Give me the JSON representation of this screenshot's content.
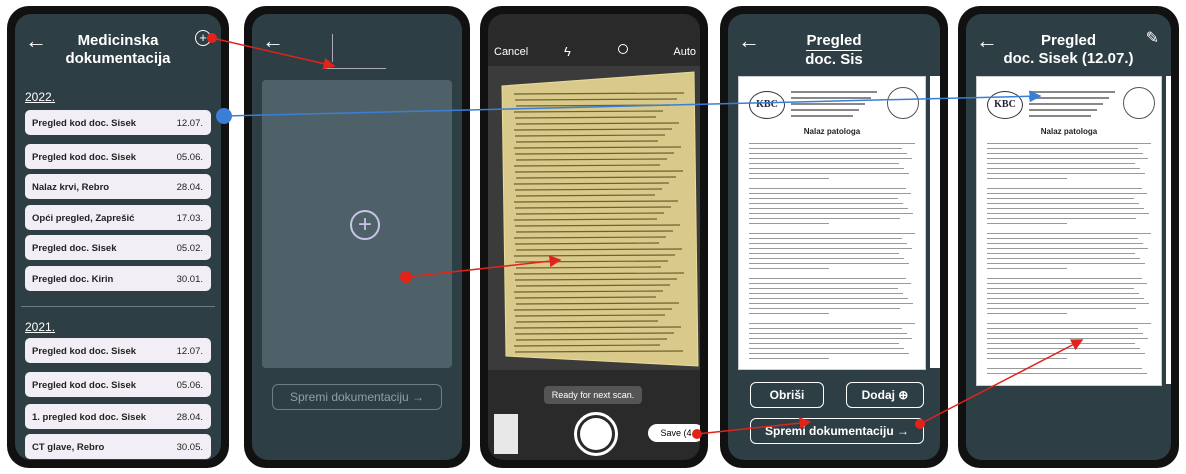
{
  "screen1": {
    "back_icon": "arrow-left-icon",
    "title_line1": "Medicinska",
    "title_line2": "dokumentacija",
    "add_icon": "plus-circle-icon",
    "year1": "2022.",
    "items2022": [
      {
        "label": "Pregled kod doc. Sisek",
        "date": "12.07."
      },
      {
        "label": "Pregled kod doc. Sisek",
        "date": "05.06."
      },
      {
        "label": "Nalaz krvi, Rebro",
        "date": "28.04."
      },
      {
        "label": "Opći pregled, Zaprešić",
        "date": "17.03."
      },
      {
        "label": "Pregled doc. Sisek",
        "date": "05.02."
      },
      {
        "label": "Pregled doc. Kirin",
        "date": "30.01."
      }
    ],
    "year2": "2021.",
    "items2021": [
      {
        "label": "Pregled kod doc. Sisek",
        "date": "12.07."
      },
      {
        "label": "Pregled kod doc. Sisek",
        "date": "05.06."
      },
      {
        "label": "1. pregled kod doc. Sisek",
        "date": "28.04."
      },
      {
        "label": "CT glave, Rebro",
        "date": "30.05."
      }
    ]
  },
  "screen2": {
    "back_icon": "arrow-left-icon",
    "add_icon": "plus-circle-icon",
    "save_label": "Spremi dokumentaciju →"
  },
  "screen3": {
    "cancel": "Cancel",
    "flash_icon": "lightning-icon",
    "filter_icon": "filter-icon",
    "auto": "Auto",
    "toast": "Ready for next scan.",
    "save": "Save (4"
  },
  "screen4": {
    "back_icon": "arrow-left-icon",
    "title_line1": "Pregled",
    "title_line2": "doc. Sis",
    "delete": "Obriši",
    "add": "Dodaj ⊕",
    "save": "Spremi dokumentaciju →"
  },
  "screen5": {
    "back_icon": "arrow-left-icon",
    "title_line1": "Pregled",
    "title_line2": "doc. Sisek (12.07.)",
    "edit_icon": "pencil-icon"
  },
  "document": {
    "logo": "KBC",
    "heading": "Nalaz patologa"
  },
  "colors": {
    "screen_bg": "#2d3e45",
    "item_bg": "#f1eff5",
    "arrow_red": "#e2231a",
    "arrow_blue": "#3a7fd5"
  }
}
